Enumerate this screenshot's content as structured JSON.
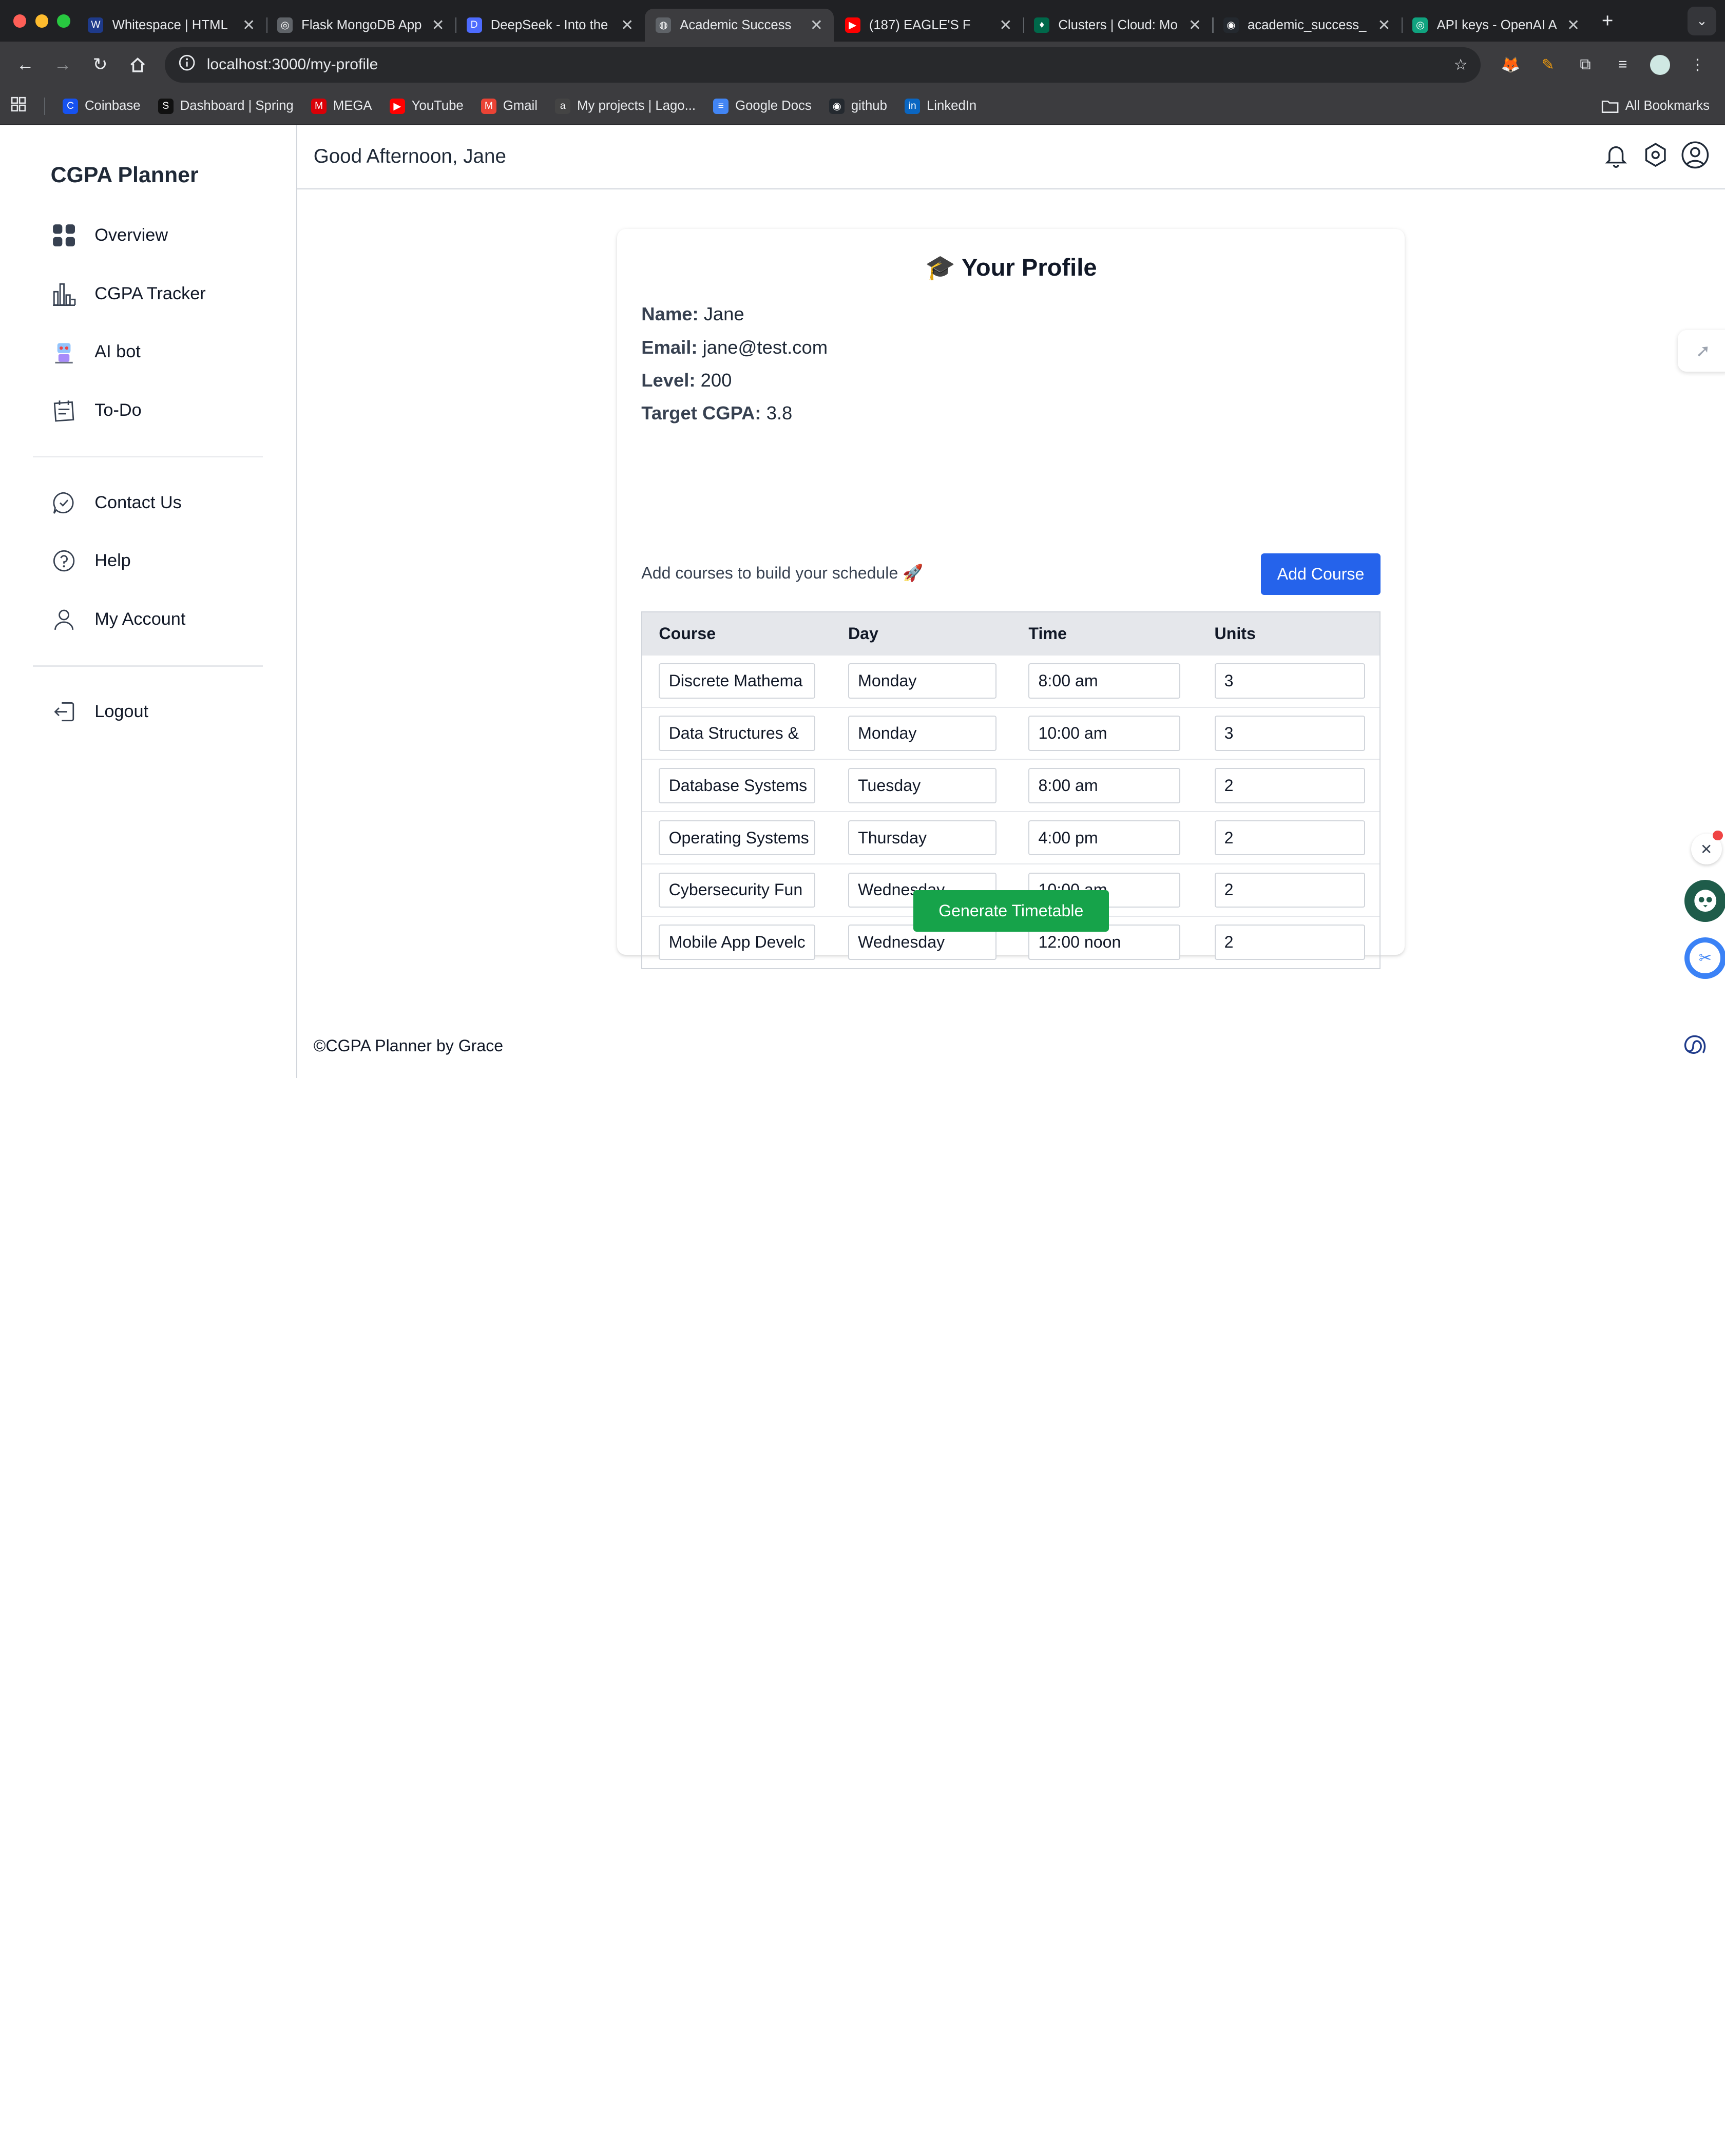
{
  "browser": {
    "tabs": [
      {
        "title": "Whitespace | HTML",
        "fav": "#1e3a8a",
        "glyph": "W",
        "active": false
      },
      {
        "title": "Flask MongoDB App",
        "fav": "#5f6368",
        "glyph": "◎",
        "active": false
      },
      {
        "title": "DeepSeek - Into the",
        "fav": "#4d6bfe",
        "glyph": "D",
        "active": false
      },
      {
        "title": "Academic Success",
        "fav": "#5f6368",
        "glyph": "◍",
        "active": true
      },
      {
        "title": "(187) EAGLE'S F",
        "fav": "#ff0000",
        "glyph": "▶",
        "active": false
      },
      {
        "title": "Clusters | Cloud: Mo",
        "fav": "#00684a",
        "glyph": "♦",
        "active": false
      },
      {
        "title": "academic_success_",
        "fav": "#24292f",
        "glyph": "◉",
        "active": false
      },
      {
        "title": "API keys - OpenAI A",
        "fav": "#10a37f",
        "glyph": "◎",
        "active": false
      }
    ],
    "url": "localhost:3000/my-profile",
    "bookmarks": [
      {
        "label": "Coinbase",
        "color": "#1652f0",
        "glyph": "C"
      },
      {
        "label": "Dashboard | Spring",
        "color": "#111111",
        "glyph": "S"
      },
      {
        "label": "MEGA",
        "color": "#d90007",
        "glyph": "M"
      },
      {
        "label": "YouTube",
        "color": "#ff0000",
        "glyph": "▶"
      },
      {
        "label": "Gmail",
        "color": "#ea4335",
        "glyph": "M"
      },
      {
        "label": "My projects | Lago...",
        "color": "#444444",
        "glyph": "a"
      },
      {
        "label": "Google Docs",
        "color": "#4285f4",
        "glyph": "≡"
      },
      {
        "label": "github",
        "color": "#24292f",
        "glyph": "◉"
      },
      {
        "label": "LinkedIn",
        "color": "#0a66c2",
        "glyph": "in"
      }
    ],
    "all_bookmarks": "All Bookmarks"
  },
  "sidebar": {
    "brand": "CGPA Planner",
    "items": [
      {
        "label": "Overview",
        "icon": "grid-icon"
      },
      {
        "label": "CGPA Tracker",
        "icon": "bar-chart-icon"
      },
      {
        "label": "AI bot",
        "icon": "robot-icon"
      },
      {
        "label": "To-Do",
        "icon": "calendar-icon"
      },
      {
        "label": "Contact Us",
        "icon": "chat-icon"
      },
      {
        "label": "Help",
        "icon": "help-icon"
      },
      {
        "label": "My Account",
        "icon": "user-icon"
      },
      {
        "label": "Logout",
        "icon": "logout-icon"
      }
    ]
  },
  "header": {
    "greeting": "Good Afternoon, Jane"
  },
  "profile": {
    "title": "🎓 Your Profile",
    "name_label": "Name:",
    "name": "Jane",
    "email_label": "Email:",
    "email": "jane@test.com",
    "level_label": "Level:",
    "level": "200",
    "target_label": "Target CGPA:",
    "target": "3.8",
    "prompt": "Add courses to build your schedule 🚀",
    "add_course": "Add Course",
    "generate": "Generate Timetable"
  },
  "table": {
    "headers": [
      "Course",
      "Day",
      "Time",
      "Units"
    ],
    "rows": [
      [
        "Discrete Mathema",
        "Monday",
        "8:00 am",
        "3"
      ],
      [
        "Data Structures &",
        "Monday",
        "10:00 am",
        "3"
      ],
      [
        "Database Systems",
        "Tuesday",
        "8:00 am",
        "2"
      ],
      [
        "Operating Systems",
        "Thursday",
        "4:00 pm",
        "2"
      ],
      [
        "Cybersecurity Fun",
        "Wednesday",
        "10:00 am",
        "2"
      ],
      [
        "Mobile App Develc",
        "Wednesday",
        "12:00 noon",
        "2"
      ]
    ]
  },
  "footer": "©CGPA Planner by Grace",
  "colors": {
    "primary": "#2563eb",
    "success": "#16a34a",
    "chrome_dark": "#202124"
  }
}
